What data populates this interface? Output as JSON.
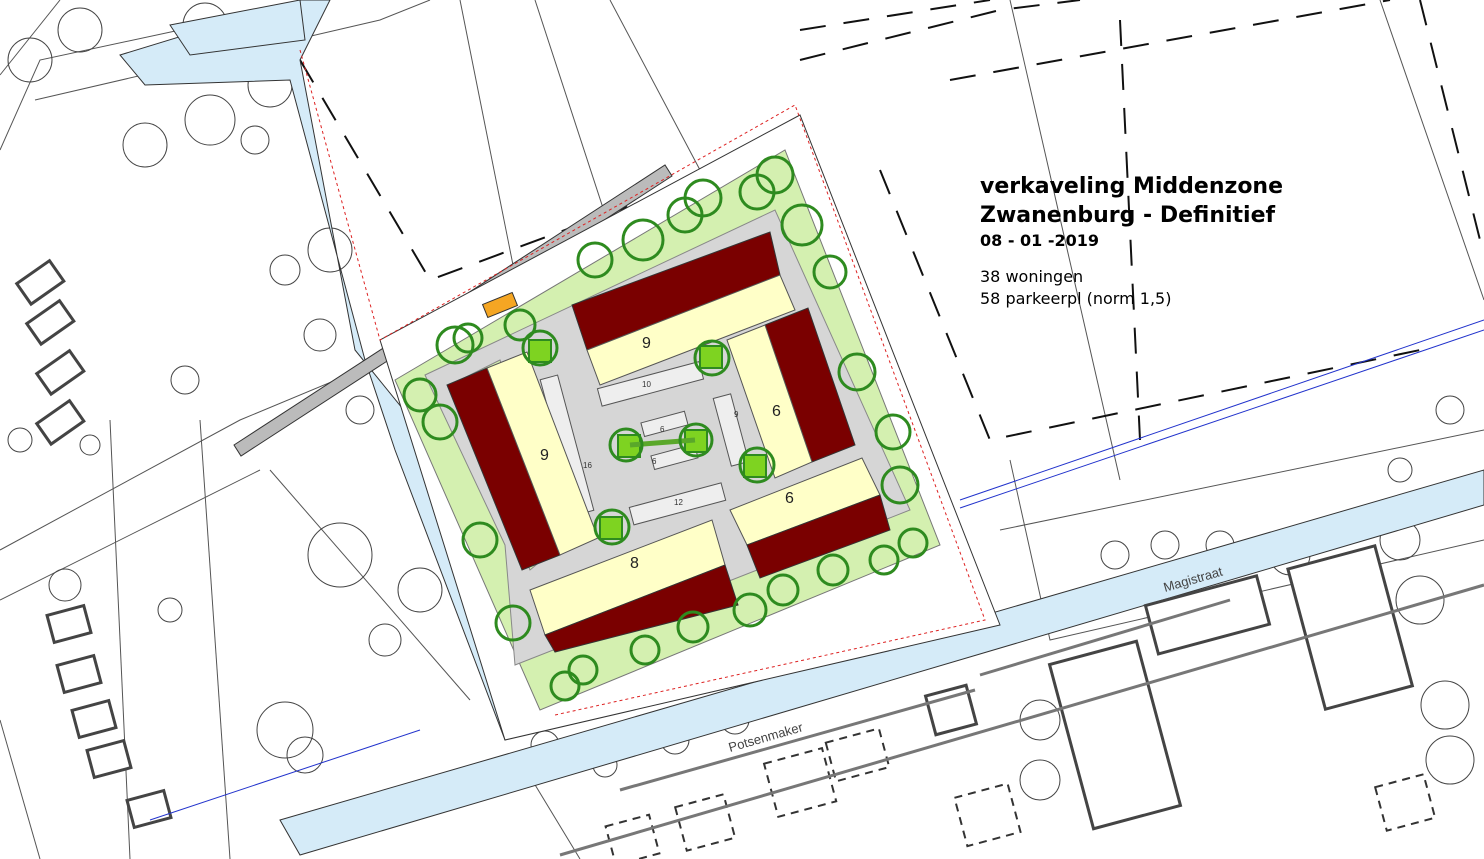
{
  "title": {
    "line1": "verkaveling Middenzone",
    "line2": "Zwanenburg - Definitief",
    "date": "08 - 01 -2019"
  },
  "stats": {
    "dwellings": "38 woningen",
    "parking": "58 parkeerpl (norm 1,5)"
  },
  "blocks": {
    "north": "9",
    "west": "9",
    "east": "6",
    "southeast": "6",
    "south": "8"
  },
  "parking_counts": {
    "north": "10",
    "west": "16",
    "east": "9",
    "south": "12",
    "center_top": "6",
    "center_bottom": "6"
  },
  "streets": {
    "magistraat": "Magistraat",
    "potsenmaker": "Potsenmaker"
  },
  "colors": {
    "housing": "#7a0000",
    "garden": "#ffffc8",
    "green": "#d4f0b0",
    "water": "#d5ebf8",
    "tree": "#2e8b1f",
    "paving": "#d6d6d6"
  }
}
